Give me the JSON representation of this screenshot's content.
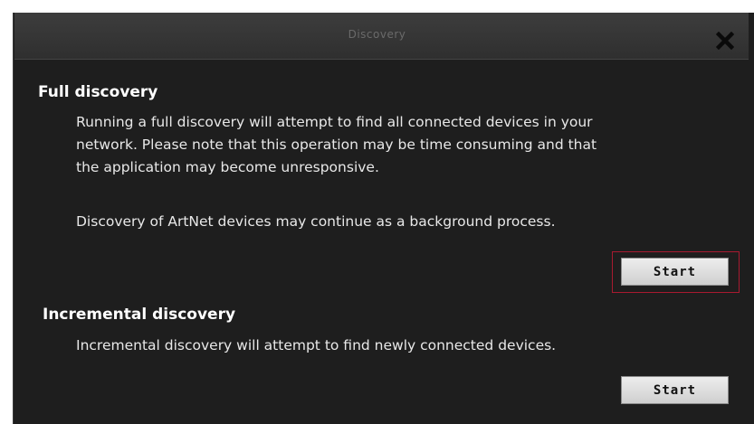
{
  "dialog": {
    "title": "Discovery",
    "close_icon": "close-icon"
  },
  "full_discovery": {
    "heading": "Full discovery",
    "line1": "Running a full discovery will attempt to find all connected devices in your",
    "line2": "network. Please note that this operation may be time consuming and that",
    "line3": "the application may become unresponsive.",
    "note": "Discovery of ArtNet devices may continue as a background process.",
    "start_label": "Start"
  },
  "incremental_discovery": {
    "heading": "Incremental discovery",
    "description": "Incremental discovery will attempt to find newly connected devices.",
    "start_label": "Start"
  },
  "colors": {
    "background": "#1e1e1e",
    "focus_ring": "#a81a30"
  }
}
